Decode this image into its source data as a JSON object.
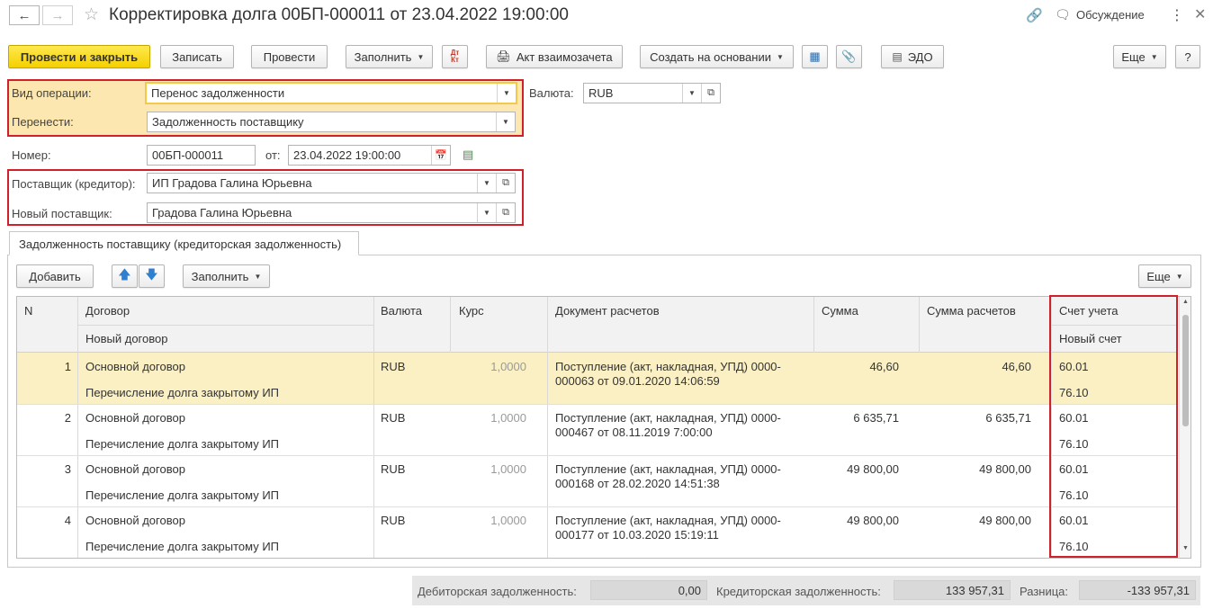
{
  "title": "Корректировка долга 00БП-000011 от 23.04.2022 19:00:00",
  "header_actions": {
    "discussion": "Обсуждение"
  },
  "toolbar": {
    "post_close": "Провести и закрыть",
    "save": "Записать",
    "post": "Провести",
    "fill": "Заполнить",
    "dt_kt": "Дт Кт",
    "netting_act": "Акт взаимозачета",
    "create_based": "Создать на основании",
    "edo": "ЭДО",
    "more": "Еще",
    "help": "?"
  },
  "form": {
    "operation_label": "Вид операции:",
    "operation_value": "Перенос задолженности",
    "transfer_label": "Перенести:",
    "transfer_value": "Задолженность поставщику",
    "currency_label": "Валюта:",
    "currency_value": "RUB",
    "number_label": "Номер:",
    "number_value": "00БП-000011",
    "date_label": "от:",
    "date_value": "23.04.2022 19:00:00",
    "supplier_label": "Поставщик (кредитор):",
    "supplier_value": "ИП Градова Галина Юрьевна",
    "new_supplier_label": "Новый поставщик:",
    "new_supplier_value": "Градова Галина Юрьевна"
  },
  "tab": {
    "label": "Задолженность поставщику (кредиторская задолженность)"
  },
  "table_toolbar": {
    "add": "Добавить",
    "fill": "Заполнить",
    "more": "Еще"
  },
  "table": {
    "columns": {
      "n": "N",
      "contract": "Договор",
      "new_contract": "Новый договор",
      "currency": "Валюта",
      "rate": "Курс",
      "doc": "Документ расчетов",
      "sum": "Сумма",
      "sum_calc": "Сумма расчетов",
      "account": "Счет учета",
      "new_account": "Новый счет"
    },
    "rows": [
      {
        "n": "1",
        "contract": "Основной договор",
        "new_contract": "Перечисление долга закрытому ИП",
        "currency": "RUB",
        "rate": "1,0000",
        "doc1": "Поступление (акт, накладная, УПД) 0000-",
        "doc2": "000063 от 09.01.2020 14:06:59",
        "sum": "46,60",
        "sum_calc": "46,60",
        "account": "60.01",
        "new_account": "76.10"
      },
      {
        "n": "2",
        "contract": "Основной договор",
        "new_contract": "Перечисление долга закрытому ИП",
        "currency": "RUB",
        "rate": "1,0000",
        "doc1": "Поступление (акт, накладная, УПД) 0000-",
        "doc2": "000467 от 08.11.2019 7:00:00",
        "sum": "6 635,71",
        "sum_calc": "6 635,71",
        "account": "60.01",
        "new_account": "76.10"
      },
      {
        "n": "3",
        "contract": "Основной договор",
        "new_contract": "Перечисление долга закрытому ИП",
        "currency": "RUB",
        "rate": "1,0000",
        "doc1": "Поступление (акт, накладная, УПД) 0000-",
        "doc2": "000168 от 28.02.2020 14:51:38",
        "sum": "49 800,00",
        "sum_calc": "49 800,00",
        "account": "60.01",
        "new_account": "76.10"
      },
      {
        "n": "4",
        "contract": "Основной договор",
        "new_contract": "Перечисление долга закрытому ИП",
        "currency": "RUB",
        "rate": "1,0000",
        "doc1": "Поступление (акт, накладная, УПД) 0000-",
        "doc2": "000177 от 10.03.2020 15:19:11",
        "sum": "49 800,00",
        "sum_calc": "49 800,00",
        "account": "60.01",
        "new_account": "76.10"
      }
    ]
  },
  "footer": {
    "debit_label": "Дебиторская задолженность:",
    "debit_value": "0,00",
    "credit_label": "Кредиторская задолженность:",
    "credit_value": "133 957,31",
    "diff_label": "Разница:",
    "diff_value": "-133 957,31"
  },
  "colors": {
    "accent_yellow": "#f4d100",
    "selected_row": "#fbf0c4",
    "highlight_red": "#d0202a",
    "group_bg": "#fde7b0"
  }
}
